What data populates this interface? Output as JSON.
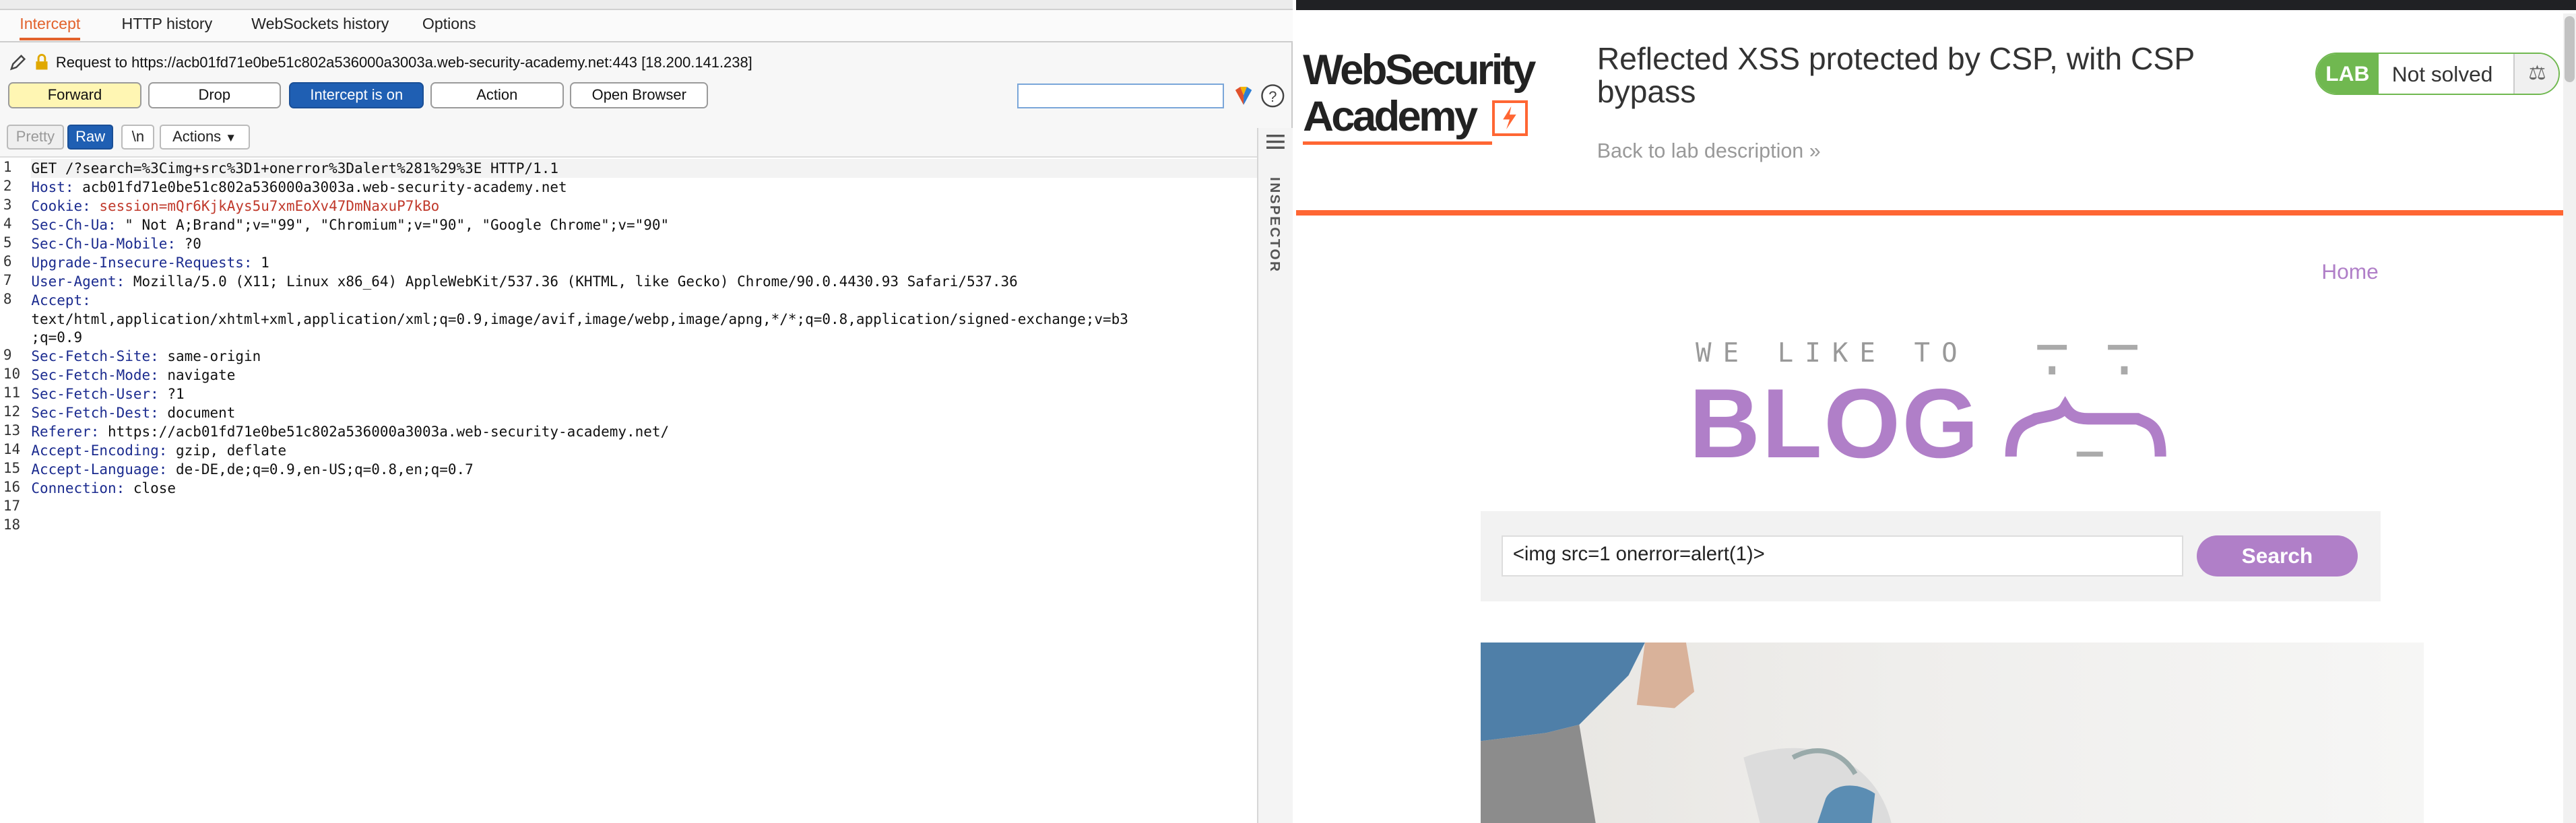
{
  "burp": {
    "subtabs": [
      "Intercept",
      "HTTP history",
      "WebSockets history",
      "Options"
    ],
    "request_label": "Request to https://acb01fd71e0be51c802a536000a3003a.web-security-academy.net:443  [18.200.141.238]",
    "buttons": {
      "forward": "Forward",
      "drop": "Drop",
      "intercept": "Intercept is on",
      "action": "Action",
      "open_browser": "Open Browser"
    },
    "view": {
      "pretty": "Pretty",
      "raw": "Raw",
      "newline": "\\n",
      "actions": "Actions"
    },
    "inspector_label": "INSPECTOR",
    "request_lines": [
      {
        "n": "1",
        "key": "",
        "val": "GET /?search=%3Cimg+src%3D1+onerror%3Dalert%281%29%3E HTTP/1.1"
      },
      {
        "n": "2",
        "key": "Host:",
        "val": " acb01fd71e0be51c802a536000a3003a.web-security-academy.net"
      },
      {
        "n": "3",
        "key": "Cookie:",
        "val": " session=mQr6KjkAys5u7xmEoXv47DmNaxuP7kBo"
      },
      {
        "n": "4",
        "key": "Sec-Ch-Ua:",
        "val": " \" Not A;Brand\";v=\"99\", \"Chromium\";v=\"90\", \"Google Chrome\";v=\"90\""
      },
      {
        "n": "5",
        "key": "Sec-Ch-Ua-Mobile:",
        "val": " ?0"
      },
      {
        "n": "6",
        "key": "Upgrade-Insecure-Requests:",
        "val": " 1"
      },
      {
        "n": "7",
        "key": "User-Agent:",
        "val": " Mozilla/5.0 (X11; Linux x86_64) AppleWebKit/537.36 (KHTML, like Gecko) Chrome/90.0.4430.93 Safari/537.36"
      },
      {
        "n": "8",
        "key": "Accept:",
        "val": ""
      },
      {
        "n": "",
        "key": "",
        "val": "text/html,application/xhtml+xml,application/xml;q=0.9,image/avif,image/webp,image/apng,*/*;q=0.8,application/signed-exchange;v=b3"
      },
      {
        "n": "",
        "key": "",
        "val": ";q=0.9"
      },
      {
        "n": "9",
        "key": "Sec-Fetch-Site:",
        "val": " same-origin"
      },
      {
        "n": "10",
        "key": "Sec-Fetch-Mode:",
        "val": " navigate"
      },
      {
        "n": "11",
        "key": "Sec-Fetch-User:",
        "val": " ?1"
      },
      {
        "n": "12",
        "key": "Sec-Fetch-Dest:",
        "val": " document"
      },
      {
        "n": "13",
        "key": "Referer:",
        "val": " https://acb01fd71e0be51c802a536000a3003a.web-security-academy.net/"
      },
      {
        "n": "14",
        "key": "Accept-Encoding:",
        "val": " gzip, deflate"
      },
      {
        "n": "15",
        "key": "Accept-Language:",
        "val": " de-DE,de;q=0.9,en-US;q=0.8,en;q=0.7"
      },
      {
        "n": "16",
        "key": "Connection:",
        "val": " close"
      },
      {
        "n": "17",
        "key": "",
        "val": ""
      },
      {
        "n": "18",
        "key": "",
        "val": ""
      }
    ]
  },
  "browser": {
    "address_text": "acb01fd71e0be51c802a536000a3003a.web-security-academy.net",
    "logo_line1": "WebSecurity",
    "logo_line2": "Academy",
    "lab_title": "Reflected XSS protected by CSP, with CSP bypass",
    "back_link": "Back to lab description",
    "lab_badge": "LAB",
    "lab_status": "Not solved",
    "nav_home": "Home",
    "blog_tagline": "WE LIKE TO",
    "blog_word": "BLOG",
    "search_value": "<img src=1 onerror=alert(1)>",
    "search_button": "Search",
    "colors": {
      "accent_orange": "#ff6633",
      "blog_purple": "#b07fc8",
      "lab_green": "#70b850",
      "burp_blue": "#1f5fb3"
    }
  }
}
